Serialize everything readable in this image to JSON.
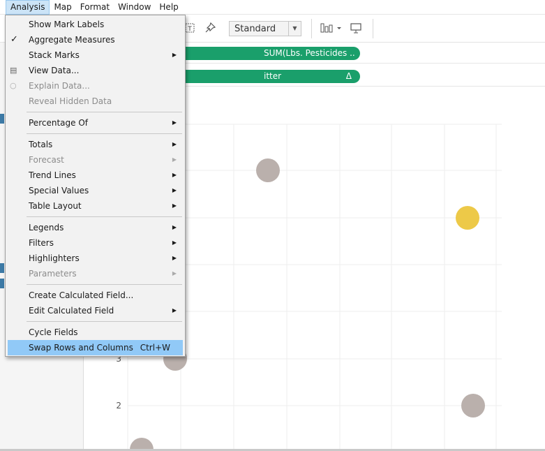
{
  "menubar": {
    "items": [
      "Analysis",
      "Map",
      "Format",
      "Window",
      "Help"
    ],
    "active": "Analysis"
  },
  "toolbar": {
    "view_select": "Standard",
    "icons": [
      "text-label-icon",
      "pin-icon",
      "show-me-icon",
      "presentation-icon"
    ]
  },
  "shelves": {
    "columns_pill": "SUM(Lbs. Pesticides ..",
    "rows_pill": "itter",
    "rows_pill_delta": "Δ"
  },
  "chart_data": {
    "type": "scatter",
    "y_tick_labels": [
      "3",
      "2"
    ],
    "points_partial": [
      {
        "color": "#bab0ac"
      },
      {
        "color": "#edc948"
      },
      {
        "color": "#bab0ac"
      },
      {
        "color": "#bab0ac"
      },
      {
        "color": "#bab0ac"
      }
    ],
    "grid": true
  },
  "menu": {
    "items": [
      {
        "label": "Show Mark Labels"
      },
      {
        "label": "Aggregate Measures",
        "checked": true
      },
      {
        "label": "Stack Marks",
        "submenu": true
      },
      {
        "label": "View Data...",
        "icon": "view-data-icon"
      },
      {
        "label": "Explain Data...",
        "icon": "lightbulb-icon",
        "disabled": true
      },
      {
        "label": "Reveal Hidden Data",
        "disabled": true
      },
      {
        "separator": true
      },
      {
        "label": "Percentage Of",
        "submenu": true
      },
      {
        "separator": true
      },
      {
        "label": "Totals",
        "submenu": true
      },
      {
        "label": "Forecast",
        "submenu": true,
        "disabled": true
      },
      {
        "label": "Trend Lines",
        "submenu": true
      },
      {
        "label": "Special Values",
        "submenu": true
      },
      {
        "label": "Table Layout",
        "submenu": true
      },
      {
        "separator": true
      },
      {
        "label": "Legends",
        "submenu": true
      },
      {
        "label": "Filters",
        "submenu": true
      },
      {
        "label": "Highlighters",
        "submenu": true
      },
      {
        "label": "Parameters",
        "submenu": true,
        "disabled": true
      },
      {
        "separator": true
      },
      {
        "label": "Create Calculated Field..."
      },
      {
        "label": "Edit Calculated Field",
        "submenu": true
      },
      {
        "separator": true
      },
      {
        "label": "Cycle Fields"
      },
      {
        "label": "Swap Rows and Columns",
        "shortcut": "Ctrl+W",
        "highlighted": true
      }
    ]
  }
}
